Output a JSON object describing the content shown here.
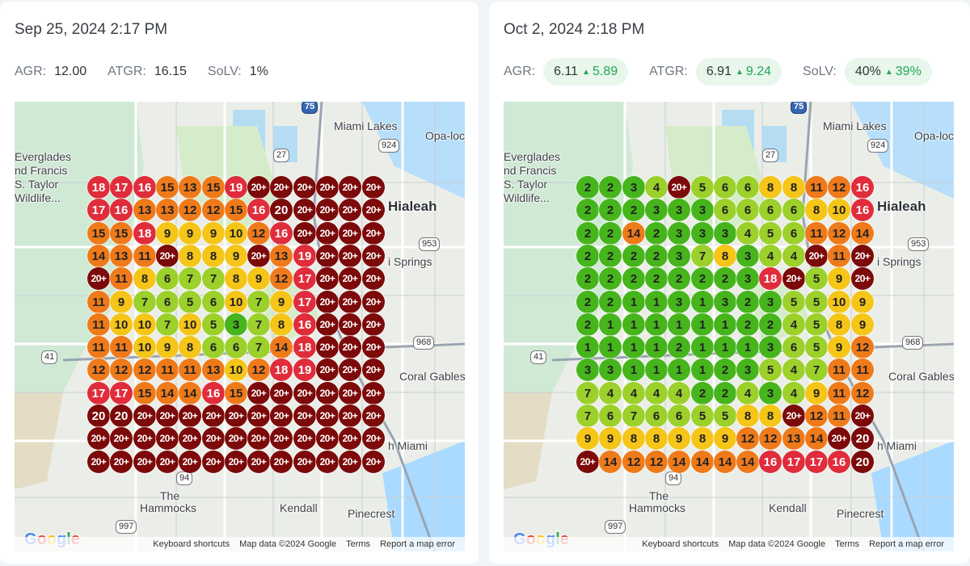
{
  "panels": [
    {
      "date": "Sep 25, 2024 2:17 PM",
      "metrics": [
        {
          "label": "AGR:",
          "value": "12.00",
          "delta": null
        },
        {
          "label": "ATGR:",
          "value": "16.15",
          "delta": null
        },
        {
          "label": "SoLV:",
          "value": "1%",
          "delta": null
        }
      ],
      "grid": [
        [
          "18",
          "17",
          "16",
          "15",
          "13",
          "15",
          "19",
          "20+",
          "20+",
          "20+",
          "20+",
          "20+",
          "20+"
        ],
        [
          "17",
          "16",
          "13",
          "13",
          "12",
          "12",
          "15",
          "16",
          "20",
          "20+",
          "20+",
          "20+",
          "20+"
        ],
        [
          "15",
          "15",
          "18",
          "9",
          "9",
          "9",
          "10",
          "12",
          "16",
          "20+",
          "20+",
          "20+",
          "20+"
        ],
        [
          "14",
          "13",
          "11",
          "20+",
          "8",
          "8",
          "9",
          "20+",
          "13",
          "19",
          "20+",
          "20+",
          "20+"
        ],
        [
          "20+",
          "11",
          "8",
          "6",
          "7",
          "7",
          "8",
          "9",
          "12",
          "17",
          "20+",
          "20+",
          "20+"
        ],
        [
          "11",
          "9",
          "7",
          "6",
          "5",
          "6",
          "10",
          "7",
          "9",
          "17",
          "20+",
          "20+",
          "20+"
        ],
        [
          "11",
          "10",
          "10",
          "7",
          "10",
          "5",
          "3",
          "7",
          "8",
          "16",
          "20+",
          "20+",
          "20+"
        ],
        [
          "11",
          "11",
          "10",
          "9",
          "8",
          "6",
          "6",
          "7",
          "14",
          "18",
          "20+",
          "20+",
          "20+"
        ],
        [
          "12",
          "12",
          "12",
          "11",
          "11",
          "13",
          "10",
          "12",
          "18",
          "19",
          "20+",
          "20+",
          "20+"
        ],
        [
          "17",
          "17",
          "15",
          "14",
          "14",
          "16",
          "15",
          "20+",
          "20+",
          "20+",
          "20+",
          "20+",
          "20+"
        ],
        [
          "20",
          "20",
          "20+",
          "20+",
          "20+",
          "20+",
          "20+",
          "20+",
          "20+",
          "20+",
          "20+",
          "20+",
          "20+"
        ],
        [
          "20+",
          "20+",
          "20+",
          "20+",
          "20+",
          "20+",
          "20+",
          "20+",
          "20+",
          "20+",
          "20+",
          "20+",
          "20+"
        ],
        [
          "20+",
          "20+",
          "20+",
          "20+",
          "20+",
          "20+",
          "20+",
          "20+",
          "20+",
          "20+",
          "20+",
          "20+",
          "20+"
        ]
      ]
    },
    {
      "date": "Oct 2, 2024 2:18 PM",
      "metrics": [
        {
          "label": "AGR:",
          "value": "6.11",
          "delta": "5.89"
        },
        {
          "label": "ATGR:",
          "value": "6.91",
          "delta": "9.24"
        },
        {
          "label": "SoLV:",
          "value": "40%",
          "delta": "39%"
        }
      ],
      "grid": [
        [
          "2",
          "2",
          "3",
          "4",
          "20+",
          "5",
          "6",
          "6",
          "8",
          "8",
          "11",
          "12",
          "16"
        ],
        [
          "2",
          "2",
          "2",
          "3",
          "3",
          "3",
          "6",
          "6",
          "6",
          "6",
          "8",
          "10",
          "16"
        ],
        [
          "2",
          "2",
          "14",
          "2",
          "3",
          "3",
          "3",
          "4",
          "5",
          "6",
          "11",
          "12",
          "14"
        ],
        [
          "2",
          "2",
          "2",
          "2",
          "3",
          "7",
          "8",
          "3",
          "4",
          "4",
          "20+",
          "11",
          "20+"
        ],
        [
          "2",
          "2",
          "2",
          "2",
          "2",
          "2",
          "2",
          "3",
          "18",
          "20+",
          "5",
          "9",
          "20+"
        ],
        [
          "2",
          "2",
          "1",
          "1",
          "3",
          "1",
          "3",
          "2",
          "3",
          "5",
          "5",
          "10",
          "9"
        ],
        [
          "2",
          "1",
          "1",
          "1",
          "1",
          "1",
          "1",
          "2",
          "2",
          "4",
          "5",
          "8",
          "9"
        ],
        [
          "1",
          "1",
          "1",
          "1",
          "2",
          "1",
          "1",
          "1",
          "3",
          "6",
          "5",
          "9",
          "12"
        ],
        [
          "3",
          "3",
          "1",
          "1",
          "1",
          "1",
          "2",
          "3",
          "5",
          "4",
          "7",
          "11",
          "11"
        ],
        [
          "7",
          "4",
          "4",
          "4",
          "4",
          "2",
          "2",
          "4",
          "3",
          "4",
          "9",
          "11",
          "12"
        ],
        [
          "7",
          "6",
          "7",
          "6",
          "6",
          "5",
          "5",
          "8",
          "8",
          "20+",
          "12",
          "11",
          "20+"
        ],
        [
          "9",
          "9",
          "8",
          "8",
          "9",
          "8",
          "9",
          "12",
          "12",
          "13",
          "14",
          "20+",
          "20"
        ],
        [
          "20+",
          "14",
          "12",
          "12",
          "14",
          "14",
          "14",
          "14",
          "16",
          "17",
          "17",
          "16",
          "20"
        ]
      ]
    }
  ],
  "map": {
    "labels": [
      "Miami Lakes",
      "Opa-loc",
      "Everglades",
      "nd Francis",
      "S. Taylor",
      "Wildlife...",
      "Hialeah",
      "i Springs",
      "Coral Gables",
      "h Miami",
      "The",
      "Hammocks",
      "Kendall",
      "Pinecrest"
    ],
    "shields": [
      "75",
      "924",
      "27",
      "953",
      "41",
      "968",
      "94",
      "997"
    ],
    "footer": [
      "Keyboard shortcuts",
      "Map data ©2024 Google",
      "Terms",
      "Report a map error"
    ],
    "logo": [
      "G",
      "o",
      "o",
      "g",
      "l",
      "e"
    ]
  },
  "colors": {
    "rank_1_3": "#46b51c",
    "rank_4_7": "#9cd02a",
    "rank_8_10": "#f5c518",
    "rank_11_15": "#ef7a1a",
    "rank_16_19": "#e02c3b",
    "rank_20_plus": "#7d0a0a",
    "delta_green": "#22a653",
    "pill_bg": "#e8f6ec"
  }
}
